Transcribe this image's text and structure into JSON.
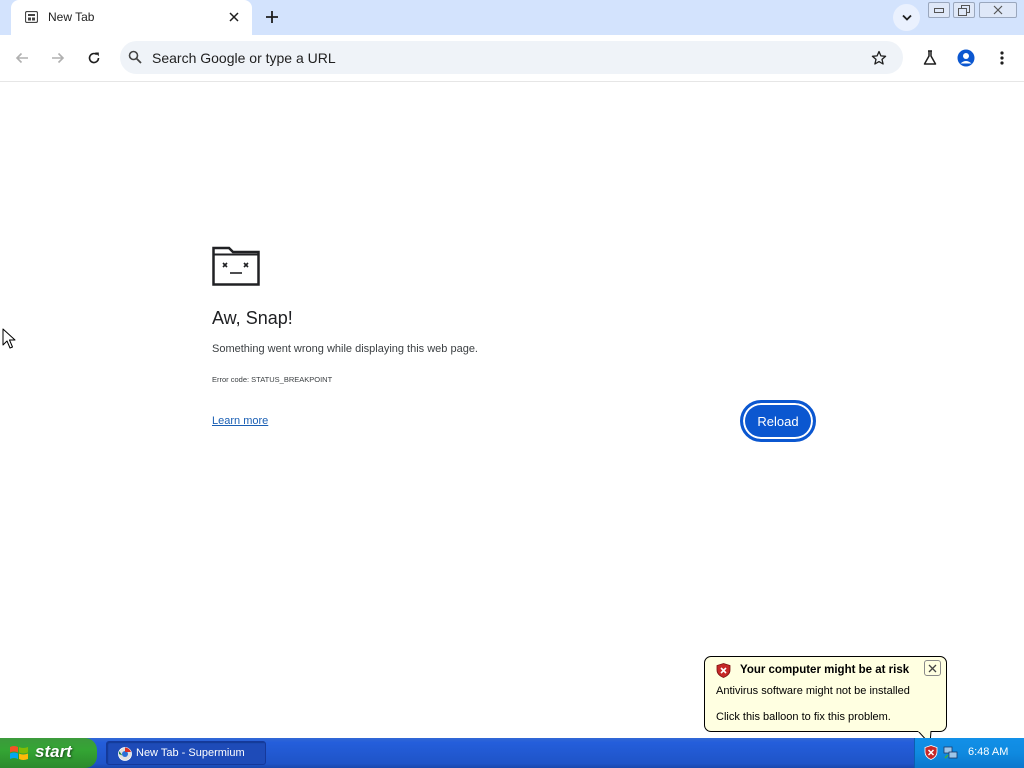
{
  "browser": {
    "tab": {
      "title": "New Tab",
      "close_glyph": "✕"
    },
    "new_tab_glyph": "+",
    "omnibox": {
      "placeholder": "Search Google or type a URL"
    }
  },
  "error_page": {
    "title": "Aw, Snap!",
    "message": "Something went wrong while displaying this web page.",
    "error_code": "Error code: STATUS_BREAKPOINT",
    "learn_more": "Learn more",
    "reload_label": "Reload"
  },
  "balloon": {
    "title": "Your computer might be at risk",
    "line1": "Antivirus software might not be installed",
    "line2": "Click this balloon to fix this problem.",
    "close_glyph": "✕"
  },
  "taskbar": {
    "start_label": "start",
    "task_label": "New Tab - Supermium",
    "clock": "6:48 AM"
  },
  "colors": {
    "tabstrip": "#d3e3fd",
    "accent": "#0b57d0",
    "link": "#1a5fb4",
    "taskbar": "#245edb",
    "start": "#34a534",
    "balloon": "#ffffe1"
  },
  "icons": [
    "new-tab-page-icon",
    "close-icon",
    "plus-icon",
    "chevron-down-icon",
    "minimize-icon",
    "restore-icon",
    "back-arrow-icon",
    "forward-arrow-icon",
    "reload-icon",
    "search-icon",
    "star-icon",
    "labs-flask-icon",
    "profile-icon",
    "more-vert-icon",
    "sad-tab-icon",
    "shield-warning-icon",
    "windows-flag-icon",
    "browser-icon",
    "network-icon",
    "mouse-cursor-icon"
  ]
}
